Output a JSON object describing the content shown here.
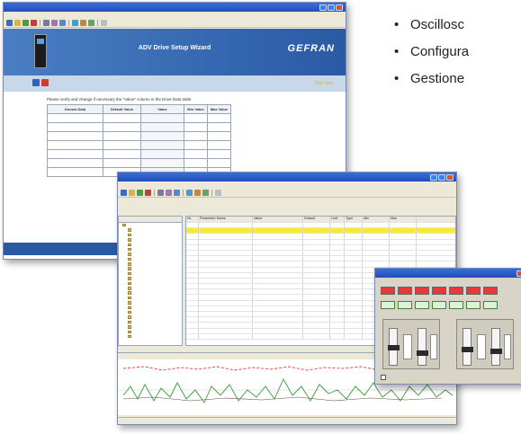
{
  "bullets": [
    {
      "text": "Oscillosc"
    },
    {
      "text": "Configura"
    },
    {
      "text": "Gestione"
    }
  ],
  "wizard": {
    "banner_title": "ADV Drive Setup Wizard",
    "logo_text": "GEFRAN",
    "skip_label": "Skip step",
    "instruction": "Please verify and change if necessary the \"Value\" column in the Drive Data table",
    "table_headers": [
      "Known Data",
      "Default Value",
      "Value",
      "Min Value",
      "Max Value"
    ]
  },
  "params": {
    "grid_headers": [
      "Nr.",
      "Parameter Name",
      "Value",
      "Default",
      "Unit",
      "Type",
      "Min",
      "Max"
    ]
  },
  "colors": {
    "title_bar": "#1f4fb8",
    "banner": "#2a5aa4",
    "highlight_row": "#ffea2a",
    "scope_red": "#e23b3b",
    "scope_green": "#3c9a3c"
  }
}
